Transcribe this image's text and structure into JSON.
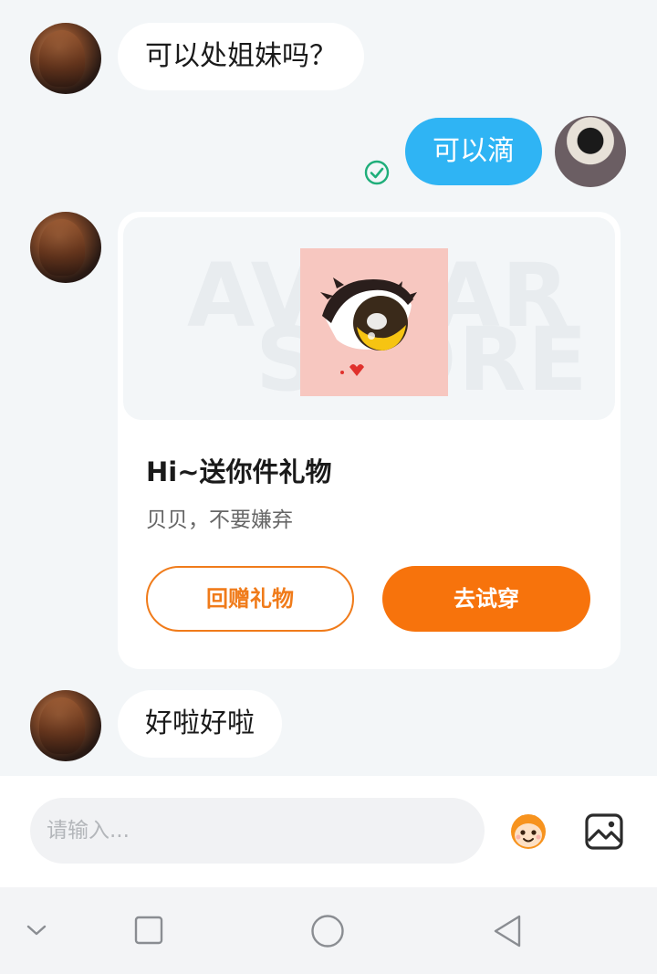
{
  "messages": [
    {
      "side": "incoming",
      "text": "可以处姐妹吗？"
    },
    {
      "side": "outgoing",
      "text": "可以滴",
      "status": "check-circle-icon"
    },
    {
      "side": "incoming",
      "text": "好啦好啦"
    }
  ],
  "gift_card": {
    "watermark_line1": "AVATAR",
    "watermark_line2": "STORE",
    "title": "Hi~送你件礼物",
    "subtitle": "贝贝，不要嫌弃",
    "return_gift_label": "回赠礼物",
    "try_on_label": "去试穿"
  },
  "composer": {
    "placeholder": "请输入...",
    "emoji_icon": "monkey-emoji-icon",
    "image_icon": "image-icon"
  },
  "system_nav": {
    "icons": [
      "chevron-down-icon",
      "square-recents-icon",
      "circle-home-icon",
      "triangle-back-icon"
    ]
  },
  "colors": {
    "outgoing_bubble": "#2fb4f4",
    "accent_orange": "#f7730c",
    "check_green": "#1fae7a",
    "background": "#f3f6f8"
  }
}
